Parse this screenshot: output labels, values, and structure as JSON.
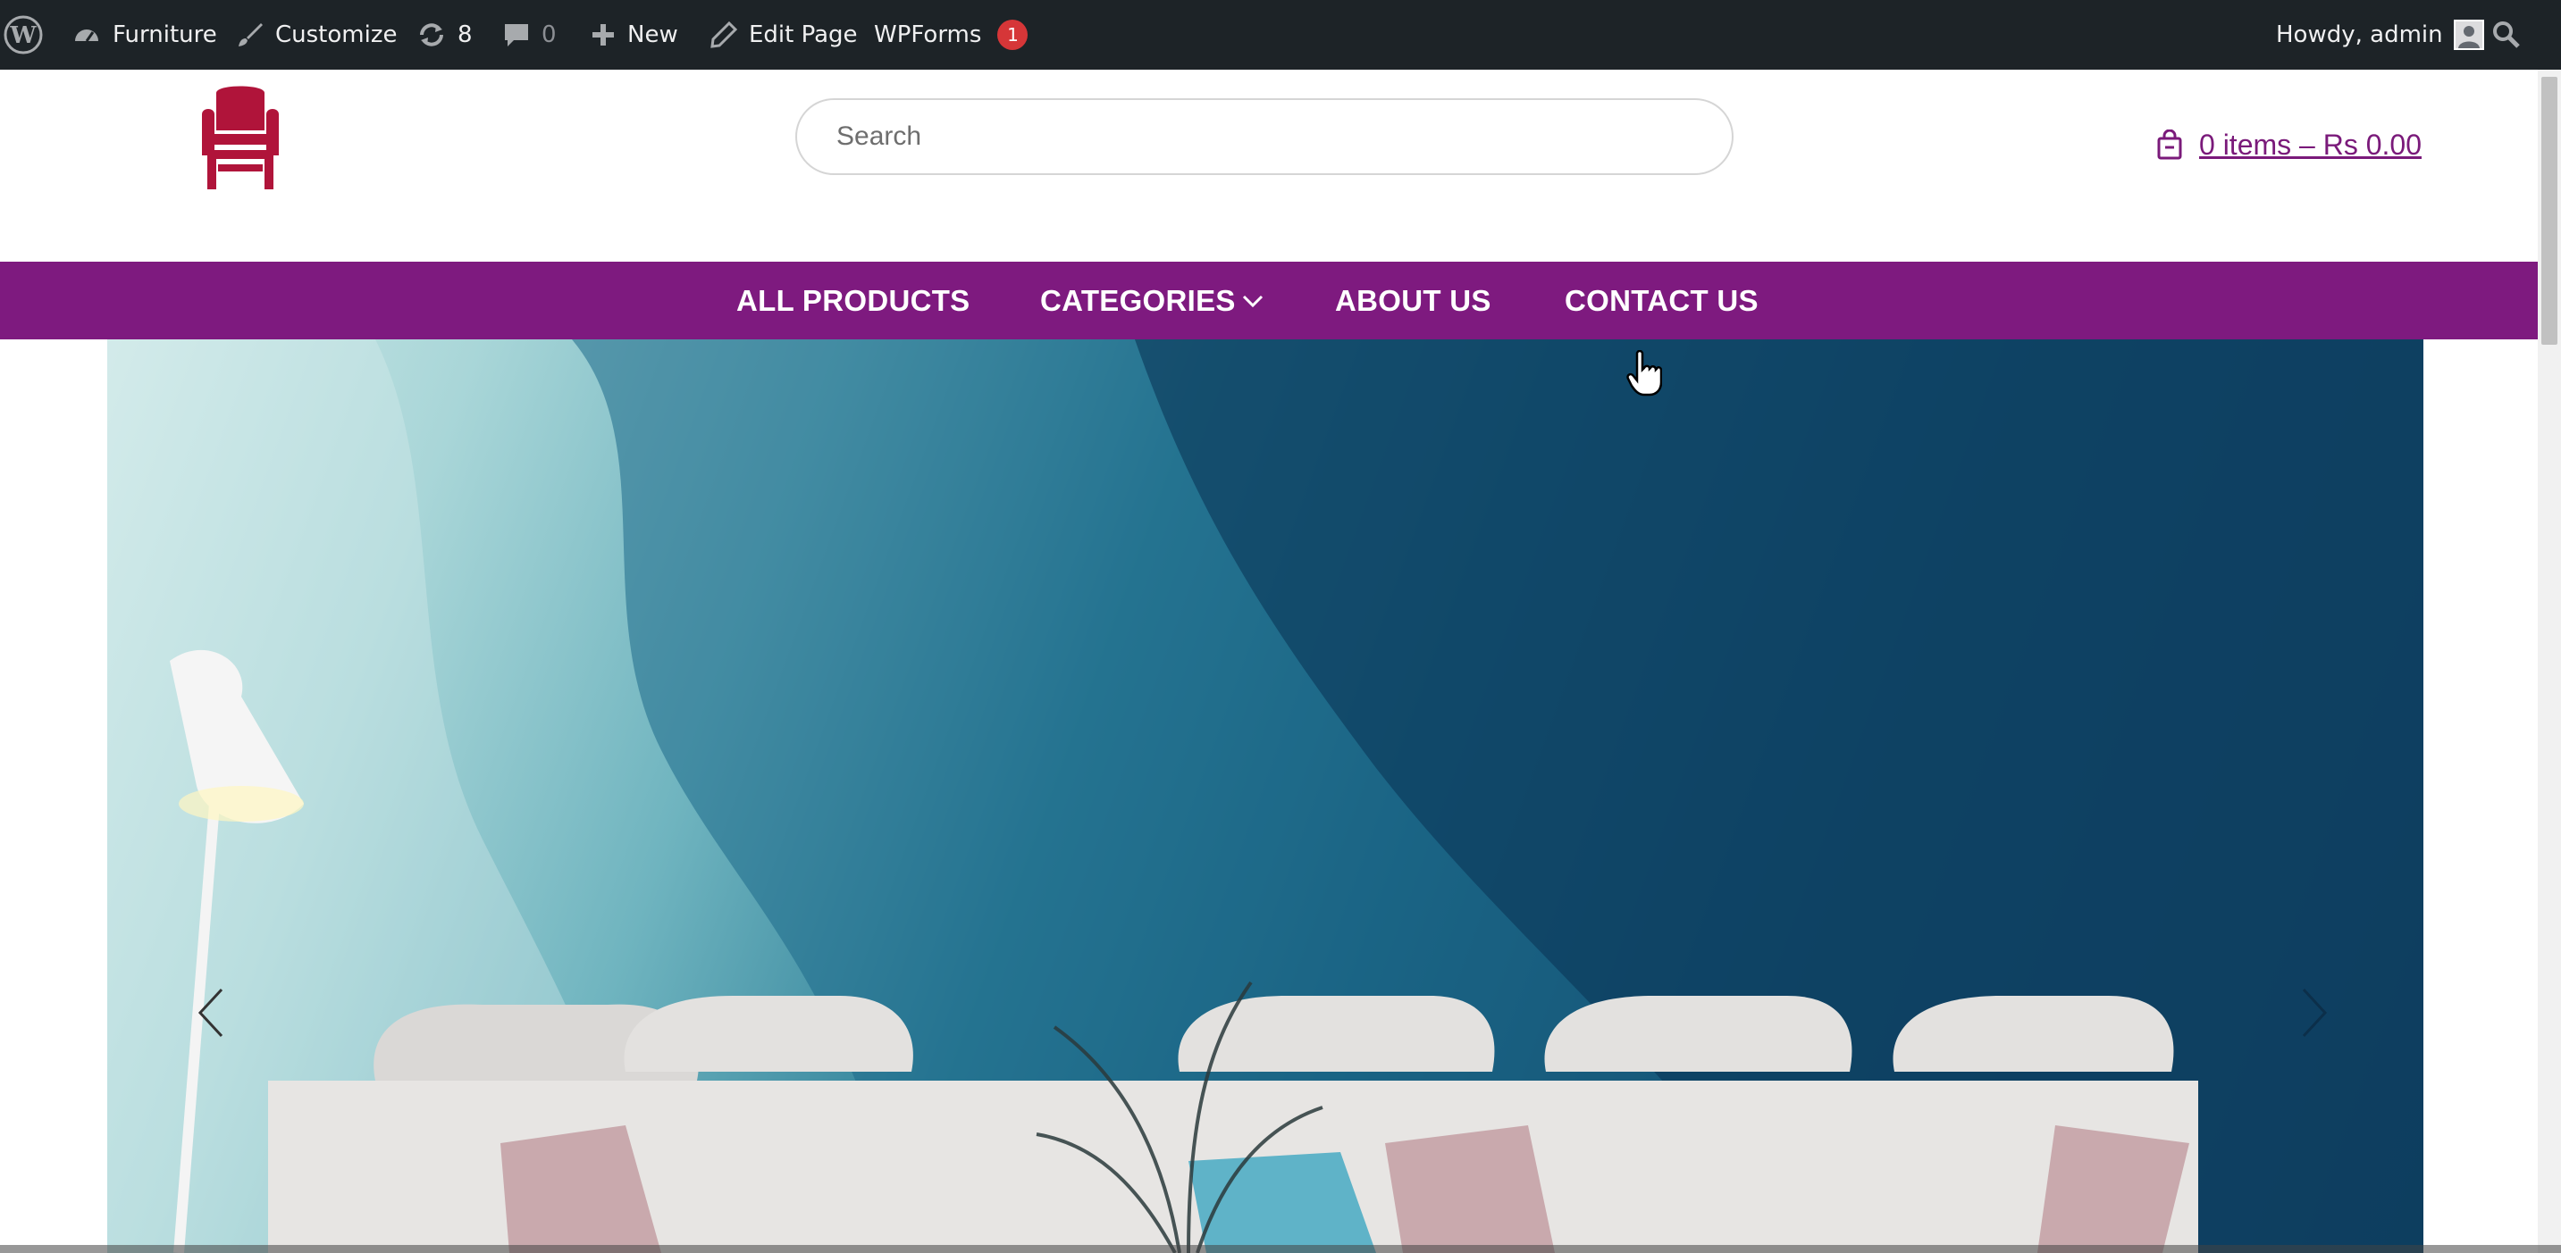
{
  "admin_bar": {
    "site_name": "Furniture",
    "customize": "Customize",
    "updates_count": "8",
    "comments_count": "0",
    "new_label": "New",
    "edit_page": "Edit Page",
    "wpforms": "WPForms",
    "wpforms_badge": "1",
    "greeting": "Howdy, admin"
  },
  "header": {
    "search_placeholder": "Search",
    "cart_text": "0 items – Rs 0.00"
  },
  "nav": {
    "items": [
      "ALL PRODUCTS",
      "CATEGORIES",
      "ABOUT US",
      "CONTACT US"
    ]
  },
  "colors": {
    "admin_bar_bg": "#1d2327",
    "brand_purple": "#7e1a7f",
    "logo_red": "#b0143a",
    "badge_red": "#d63638"
  }
}
